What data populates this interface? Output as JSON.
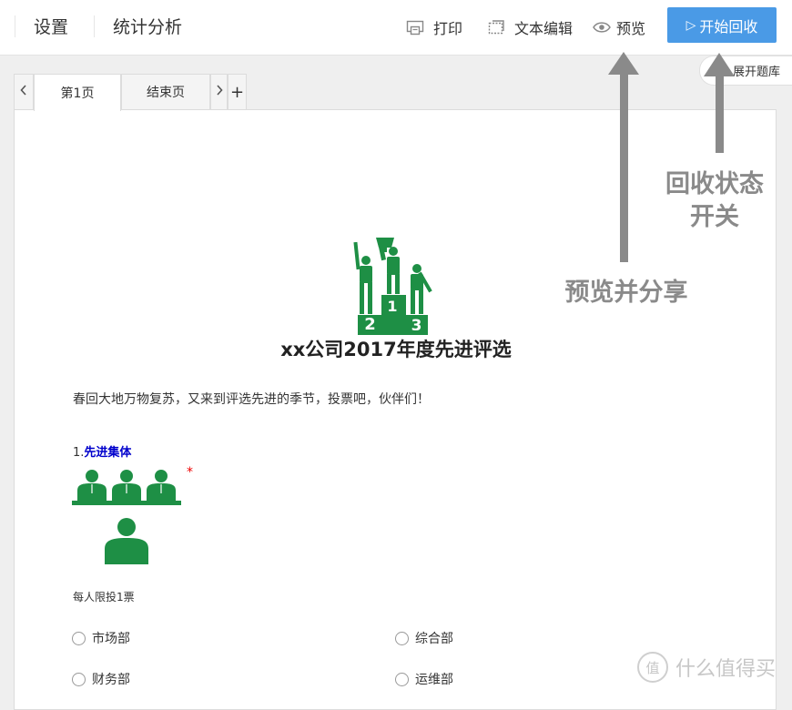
{
  "topbar": {
    "nav": [
      {
        "label": "设置"
      },
      {
        "label": "统计分析"
      }
    ],
    "tools": {
      "print": "打印",
      "text_edit": "文本编辑",
      "preview": "预览"
    },
    "start_button": "开始回收",
    "expand_bank": "展开题库"
  },
  "tabs": {
    "items": [
      {
        "label": "第1页",
        "active": true
      },
      {
        "label": "结束页",
        "active": false
      }
    ],
    "add": "+"
  },
  "survey": {
    "title": "xx公司2017年度先进评选",
    "intro": "春回大地万物复苏，又来到评选先进的季节，投票吧，伙伴们！",
    "question": {
      "number": "1.",
      "title": "先进集体",
      "required_mark": "*",
      "limit": "每人限投1票",
      "options": [
        "市场部",
        "综合部",
        "财务部",
        "运维部"
      ]
    },
    "podium_numbers": [
      "1",
      "2",
      "3"
    ]
  },
  "annotations": {
    "recycle": [
      "回收状态",
      "开关"
    ],
    "preview_share": "预览并分享"
  },
  "watermark": {
    "logo_char": "值",
    "text": "什么值得买"
  },
  "colors": {
    "accent": "#4a9ae6",
    "green": "#1e8f45",
    "annotation": "#8a8a8a",
    "question_title": "#0000cc"
  }
}
